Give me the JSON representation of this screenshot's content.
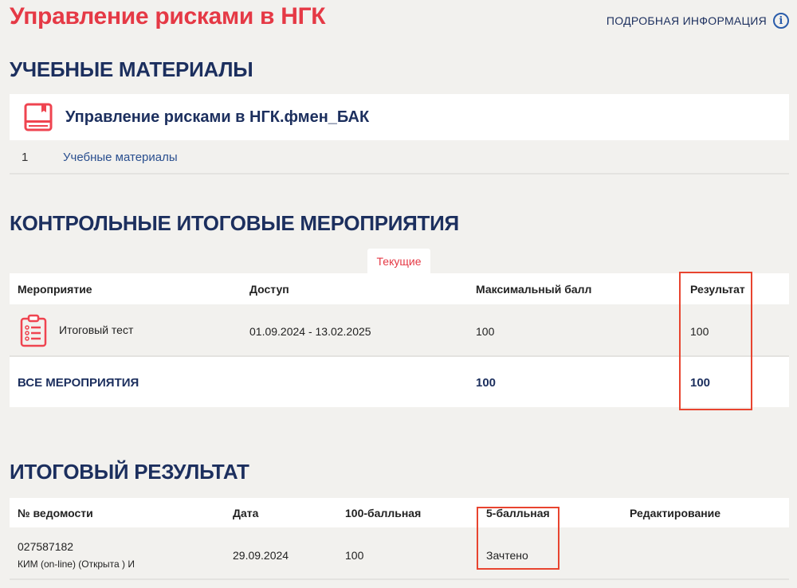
{
  "header": {
    "title": "Управление рисками в НГК",
    "info_link": "ПОДРОБНАЯ ИНФОРМАЦИЯ"
  },
  "materials": {
    "heading": "УЧЕБНЫЕ МАТЕРИАЛЫ",
    "course": "Управление рисками в НГК.фмен_БАК",
    "items": [
      {
        "num": "1",
        "label": "Учебные материалы"
      }
    ]
  },
  "events": {
    "heading": "КОНТРОЛЬНЫЕ ИТОГОВЫЕ МЕРОПРИЯТИЯ",
    "tab": "Текущие",
    "columns": [
      "Мероприятие",
      "Доступ",
      "Максимальный балл",
      "Результат"
    ],
    "rows": [
      {
        "name": "Итоговый тест",
        "access": "01.09.2024 - 13.02.2025",
        "max": "100",
        "result": "100"
      }
    ],
    "total": {
      "label": "ВСЕ МЕРОПРИЯТИЯ",
      "max": "100",
      "result": "100"
    }
  },
  "final": {
    "heading": "ИТОГОВЫЙ РЕЗУЛЬТАТ",
    "columns": [
      "№ ведомости",
      "Дата",
      "100-балльная",
      "5-балльная",
      "Редактирование"
    ],
    "rows": [
      {
        "number": "027587182",
        "type": "КИМ (on-line) (Открыта ) И",
        "date": "29.09.2024",
        "score100": "100",
        "score5": "Зачтено"
      }
    ]
  }
}
